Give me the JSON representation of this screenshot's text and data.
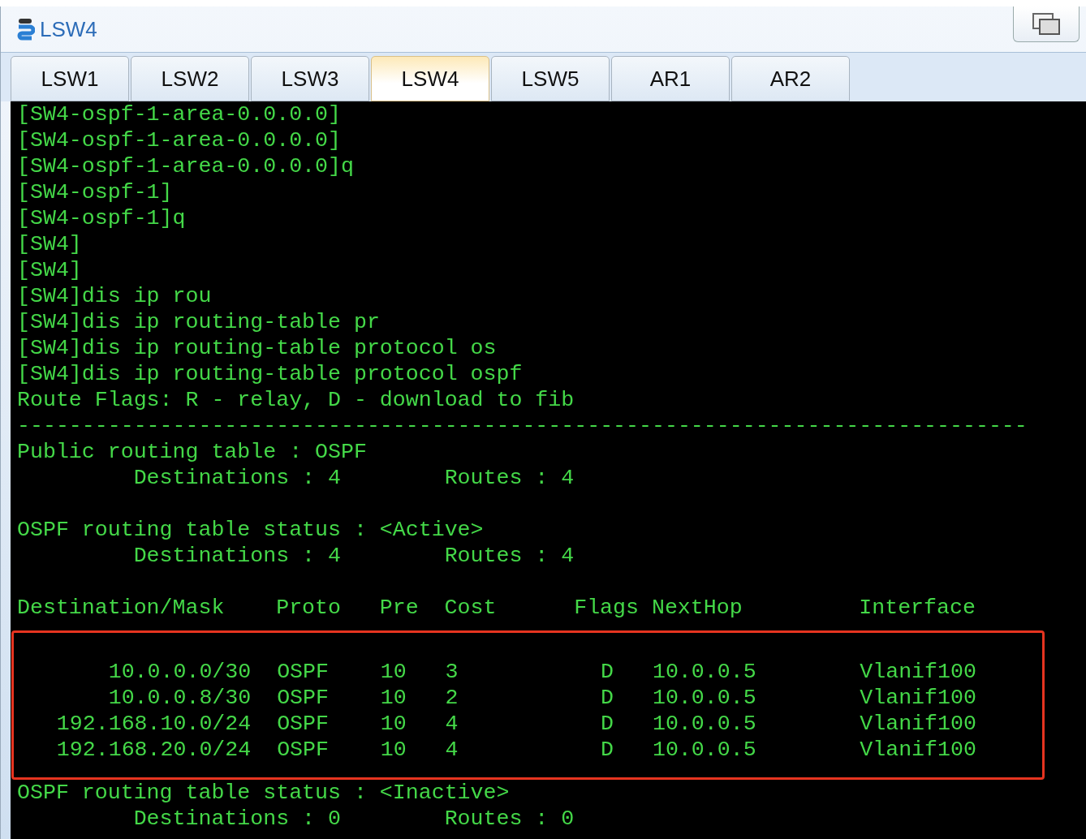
{
  "window": {
    "title": "LSW4"
  },
  "tabs": [
    {
      "label": "LSW1",
      "selected": false
    },
    {
      "label": "LSW2",
      "selected": false
    },
    {
      "label": "LSW3",
      "selected": false
    },
    {
      "label": "LSW4",
      "selected": true
    },
    {
      "label": "LSW5",
      "selected": false
    },
    {
      "label": "AR1",
      "selected": false
    },
    {
      "label": "AR2",
      "selected": false
    }
  ],
  "terminal": {
    "lines_before": [
      {
        "kind": "text",
        "text": "[SW4-ospf-1-area-0.0.0.0]"
      },
      {
        "kind": "text",
        "text": "[SW4-ospf-1-area-0.0.0.0]"
      },
      {
        "kind": "text",
        "text": "[SW4-ospf-1-area-0.0.0.0]q"
      },
      {
        "kind": "text",
        "text": "[SW4-ospf-1]"
      },
      {
        "kind": "text",
        "text": "[SW4-ospf-1]q"
      },
      {
        "kind": "text",
        "text": "[SW4]"
      },
      {
        "kind": "text",
        "text": "[SW4]"
      },
      {
        "kind": "text",
        "text": "[SW4]dis ip rou"
      },
      {
        "kind": "text",
        "text": "[SW4]dis ip routing-table pr"
      },
      {
        "kind": "text",
        "text": "[SW4]dis ip routing-table protocol os"
      },
      {
        "kind": "text",
        "text": "[SW4]dis ip routing-table protocol ospf"
      },
      {
        "kind": "text",
        "text": "Route Flags: R - relay, D - download to fib"
      },
      {
        "kind": "text",
        "text": "------------------------------------------------------------------------------"
      },
      {
        "kind": "text",
        "text": "Public routing table : OSPF"
      },
      {
        "kind": "text",
        "text": "         Destinations : 4        Routes : 4"
      },
      {
        "kind": "blank"
      },
      {
        "kind": "text",
        "text": "OSPF routing table status : <Active>"
      },
      {
        "kind": "text",
        "text": "         Destinations : 4        Routes : 4"
      },
      {
        "kind": "blank"
      }
    ],
    "route_table": {
      "highlighted": true,
      "columns": [
        "Destination/Mask",
        "Proto",
        "Pre",
        "Cost",
        "Flags",
        "NextHop",
        "Interface"
      ],
      "rows": [
        [
          "10.0.0.0/30",
          "OSPF",
          "10",
          "3",
          "D",
          "10.0.0.5",
          "Vlanif100"
        ],
        [
          "10.0.0.8/30",
          "OSPF",
          "10",
          "2",
          "D",
          "10.0.0.5",
          "Vlanif100"
        ],
        [
          "192.168.10.0/24",
          "OSPF",
          "10",
          "4",
          "D",
          "10.0.0.5",
          "Vlanif100"
        ],
        [
          "192.168.20.0/24",
          "OSPF",
          "10",
          "4",
          "D",
          "10.0.0.5",
          "Vlanif100"
        ]
      ]
    },
    "lines_after": [
      {
        "kind": "text",
        "text": "OSPF routing table status : <Inactive>"
      },
      {
        "kind": "text",
        "text": "         Destinations : 0        Routes : 0"
      }
    ]
  }
}
